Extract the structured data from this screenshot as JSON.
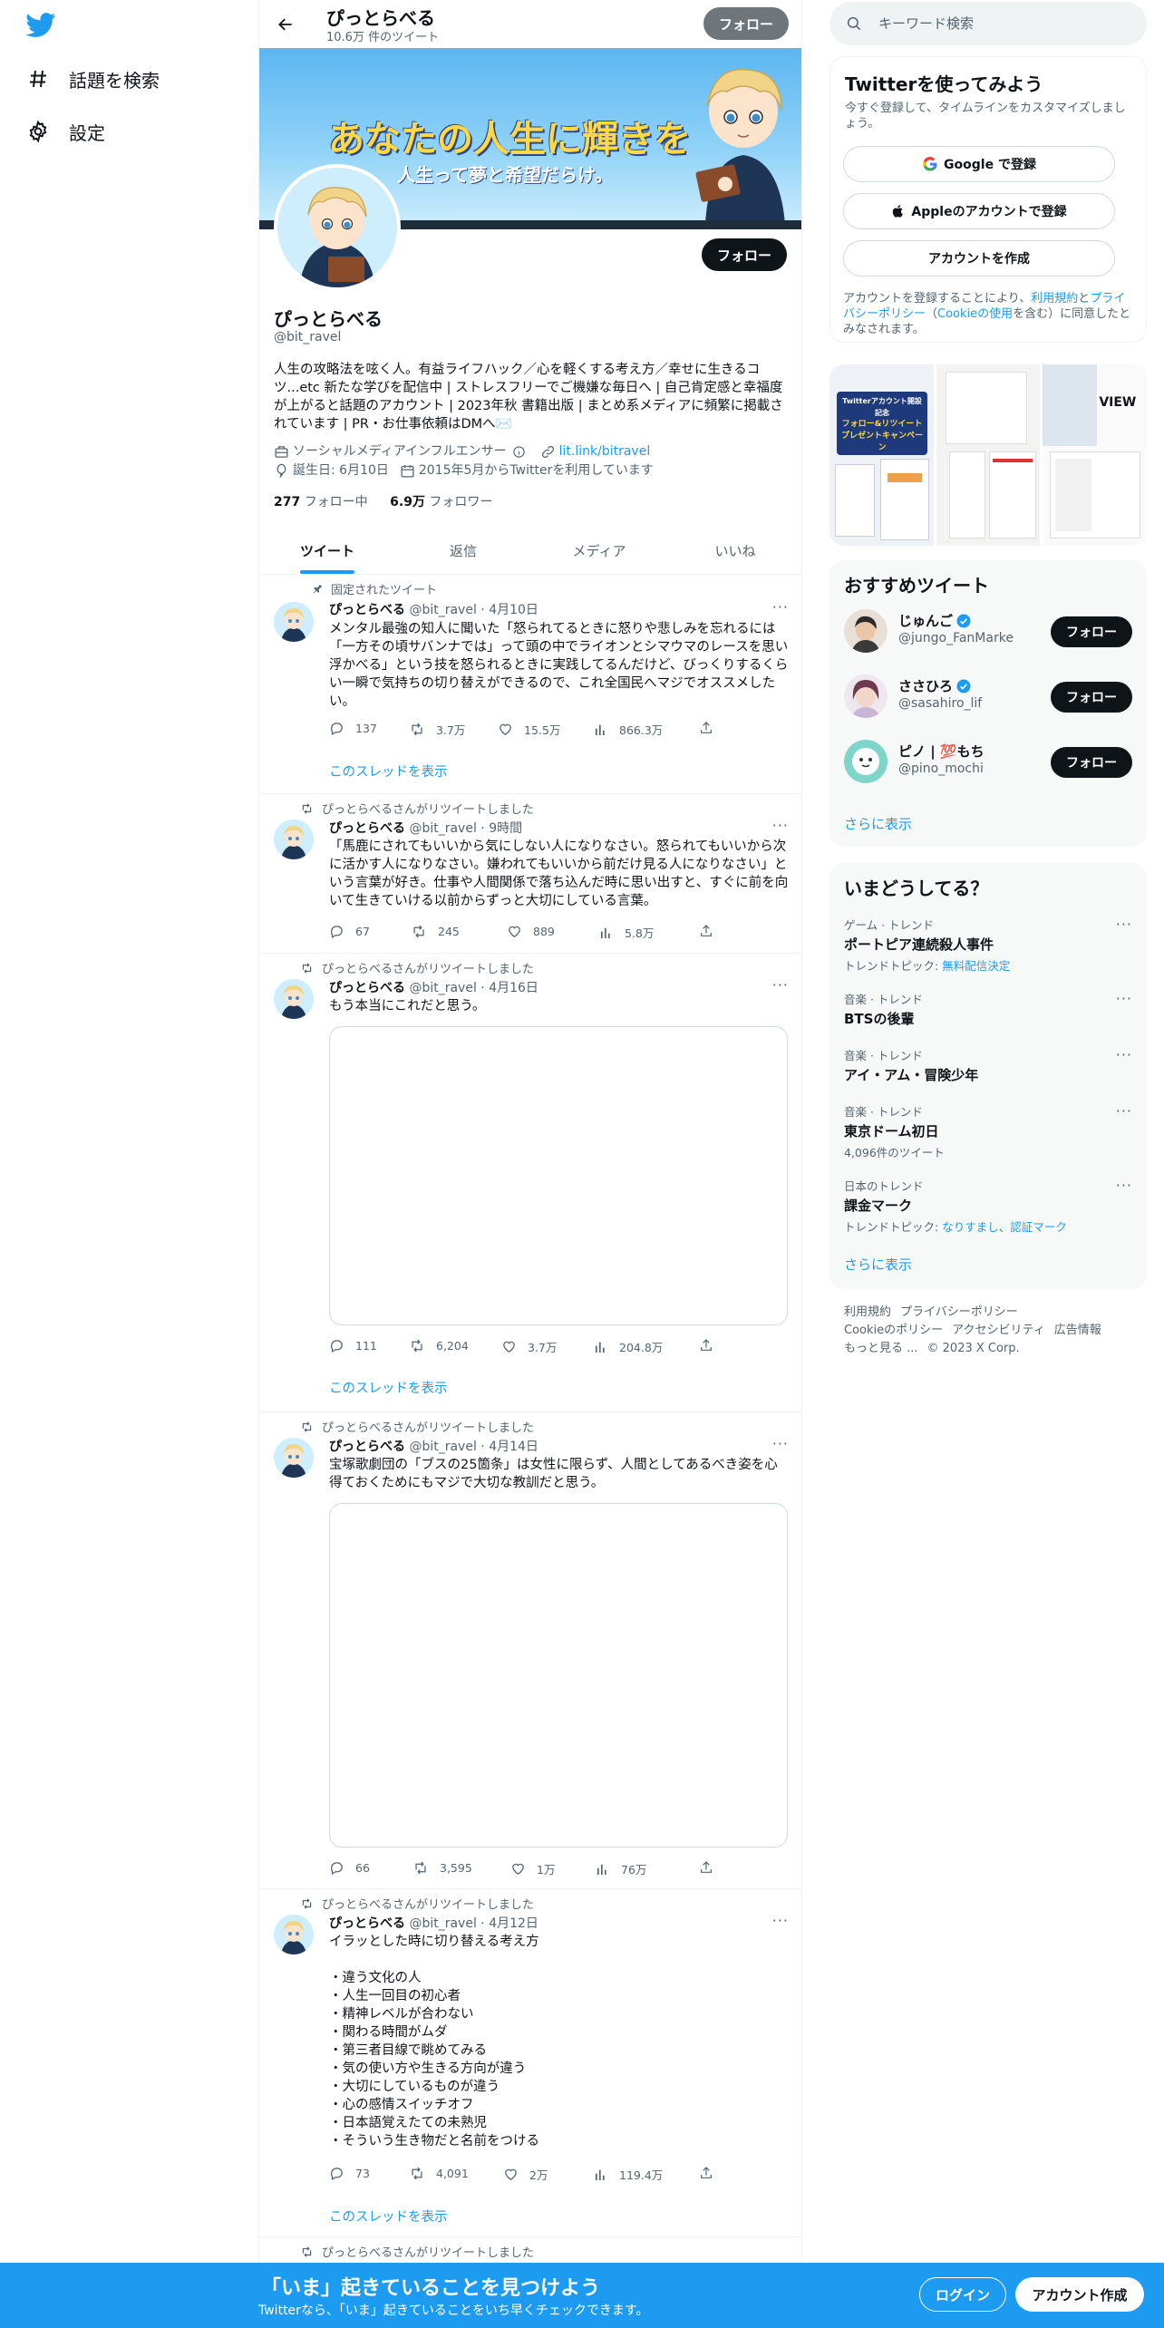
{
  "nav": {
    "explore_label": "話題を検索",
    "settings_label": "設定"
  },
  "header": {
    "name": "ぴっとらべる",
    "tweet_count": "10.6万 件のツイート",
    "follow_label": "フォロー"
  },
  "banner": {
    "line1": "あなたの人生に輝きを",
    "line2": "人生って夢と希望だらけ。"
  },
  "profile": {
    "follow_label": "フォロー",
    "name": "ぴっとらべる",
    "handle": "@bit_ravel",
    "bio": "人生の攻略法を呟く人。有益ライフハック／心を軽くする考え方／幸せに生きるコツ...etc 新たな学びを配信中 | ストレスフリーでご機嫌な毎日へ | 自己肯定感と幸福度が上がると話題のアカウント | 2023年秋 書籍出版 | まとめ系メディアに頻繁に掲載されています | PR・お仕事依頼はDMへ✉️",
    "category": "ソーシャルメディアインフルエンサー",
    "link": "lit.link/bitravel",
    "birthday": "誕生日: 6月10日",
    "joined": "2015年5月からTwitterを利用しています",
    "following_count": "277",
    "following_label": "フォロー中",
    "followers_count": "6.9万",
    "followers_label": "フォロワー"
  },
  "tabs": [
    "ツイート",
    "返信",
    "メディア",
    "いいね"
  ],
  "tweets": [
    {
      "context": "固定されたツイート",
      "name": "ぴっとらべる",
      "handle": "@bit_ravel",
      "date": "· 4月10日",
      "text": "メンタル最強の知人に聞いた「怒られてるときに怒りや悲しみを忘れるには「一方その頃サバンナでは」って頭の中でライオンとシマウマのレースを思い浮かべる」という技を怒られるときに実践してるんだけど、びっくりするくらい一瞬で気持ちの切り替えができるので、これ全国民へマジでオススメしたい。",
      "replies": "137",
      "retweets": "3.7万",
      "likes": "15.5万",
      "views": "866.3万",
      "thread_label": "このスレッドを表示"
    },
    {
      "context": "ぴっとらべるさんがリツイートしました",
      "name": "ぴっとらべる",
      "handle": "@bit_ravel",
      "date": "· 9時間",
      "text": "「馬鹿にされてもいいから気にしない人になりなさい。怒られてもいいから次に活かす人になりなさい。嫌われてもいいから前だけ見る人になりなさい」という言葉が好き。仕事や人間関係で落ち込んだ時に思い出すと、すぐに前を向いて生きていける以前からずっと大切にしている言葉。",
      "replies": "67",
      "retweets": "245",
      "likes": "889",
      "views": "5.8万"
    },
    {
      "context": "ぴっとらべるさんがリツイートしました",
      "name": "ぴっとらべる",
      "handle": "@bit_ravel",
      "date": "· 4月16日",
      "text": "もう本当にこれだと思う。",
      "replies": "111",
      "retweets": "6,204",
      "likes": "3.7万",
      "views": "204.8万",
      "thread_label": "このスレッドを表示"
    },
    {
      "context": "ぴっとらべるさんがリツイートしました",
      "name": "ぴっとらべる",
      "handle": "@bit_ravel",
      "date": "· 4月14日",
      "text": "宝塚歌劇団の「ブスの25箇条」は女性に限らず、人間としてあるべき姿を心得ておくためにもマジで大切な教訓だと思う。",
      "replies": "66",
      "retweets": "3,595",
      "likes": "1万",
      "views": "76万"
    },
    {
      "context": "ぴっとらべるさんがリツイートしました",
      "name": "ぴっとらべる",
      "handle": "@bit_ravel",
      "date": "· 4月12日",
      "text": "イラッとした時に切り替える考え方\n\n・違う文化の人\n・人生一回目の初心者\n・精神レベルが合わない\n・関わる時間がムダ\n・第三者目線で眺めてみる\n・気の使い方や生きる方向が違う\n・大切にしているものが違う\n・心の感情スイッチオフ\n・日本語覚えたての未熟児\n・そういう生き物だと名前をつける",
      "replies": "73",
      "retweets": "4,091",
      "likes": "2万",
      "views": "119.4万",
      "thread_label": "このスレッドを表示"
    },
    {
      "context": "ぴっとらべるさんがリツイートしました"
    }
  ],
  "search": {
    "placeholder": "キーワード検索"
  },
  "signup": {
    "title": "Twitterを使ってみよう",
    "subtitle": "今すぐ登録して、タイムラインをカスタマイズしましょう。",
    "google_label": "Google で登録",
    "apple_label": "Appleのアカウントで登録",
    "create_label": "アカウントを作成",
    "legal_prefix": "アカウントを登録することにより、",
    "terms": "利用規約",
    "and": "と",
    "privacy": "プライバシーポリシー",
    "cookie_pre": "（",
    "cookie": "Cookieの使用",
    "legal_suffix": "を含む）に同意したとみなされます。"
  },
  "photos": {
    "p1_line1": "Twitterアカウント開設記念",
    "p1_line2": "フォロー&リツイート",
    "p1_line3": "プレゼントキャンペーン",
    "p3_logo": "VIEW"
  },
  "recommended": {
    "title": "おすすめツイート",
    "users": [
      {
        "name": "じゅんご",
        "handle": "@jungo_FanMarke",
        "follow_label": "フォロー"
      },
      {
        "name": "ささひろ",
        "handle": "@sasahiro_lif",
        "follow_label": "フォロー"
      },
      {
        "name": "ピノ | 💯もち",
        "handle": "@pino_mochi",
        "follow_label": "フォロー"
      }
    ],
    "show_more": "さらに表示"
  },
  "trends": {
    "title": "いまどうしてる？",
    "items": [
      {
        "category": "ゲーム · トレンド",
        "name": "ポートピア連続殺人事件",
        "sub_prefix": "トレンドトピック: ",
        "sub_link": "無料配信決定"
      },
      {
        "category": "音楽 · トレンド",
        "name": "BTSの後輩"
      },
      {
        "category": "音楽 · トレンド",
        "name": "アイ・アム・冒険少年"
      },
      {
        "category": "音楽 · トレンド",
        "name": "東京ドーム初日",
        "sub_prefix": "4,096件のツイート"
      },
      {
        "category": "日本のトレンド",
        "name": "課金マーク",
        "sub_prefix": "トレンドトピック: ",
        "sub_link": "なりすまし",
        "sub_sep": "、",
        "sub_link2": "認証マーク"
      }
    ],
    "show_more": "さらに表示"
  },
  "footer": {
    "terms": "利用規約",
    "privacy": "プライバシーポリシー",
    "cookie": "Cookieのポリシー",
    "accessibility": "アクセシビリティ",
    "ads": "広告情報",
    "more": "もっと見る ...",
    "copyright": "© 2023 X Corp."
  },
  "bottom_bar": {
    "title": "「いま」起きていることを見つけよう",
    "subtitle": "Twitterなら、「いま」起きていることをいち早くチェックできます。",
    "login_label": "ログイン",
    "signup_label": "アカウント作成"
  },
  "colors": {
    "accent": "#1d9bf0",
    "text": "#0f1419",
    "muted": "#536471"
  }
}
